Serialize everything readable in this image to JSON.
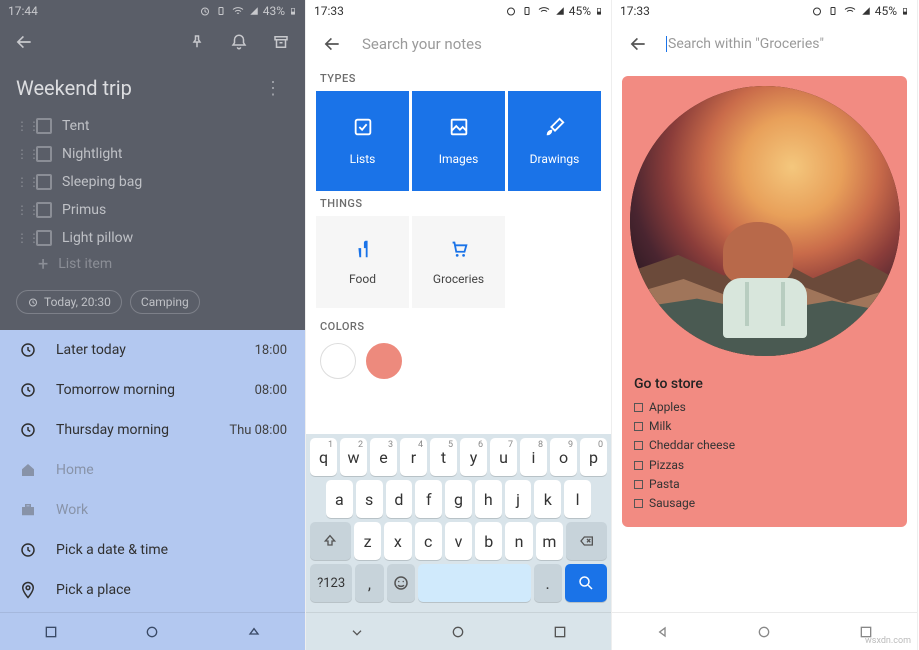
{
  "phone1": {
    "status": {
      "time": "17:44",
      "battery": "43%"
    },
    "title": "Weekend trip",
    "items": [
      "Tent",
      "Nightlight",
      "Sleeping bag",
      "Primus",
      "Light pillow"
    ],
    "add_placeholder": "List item",
    "chips": {
      "reminder": "Today, 20:30",
      "tag": "Camping"
    },
    "sheet": {
      "later": {
        "label": "Later today",
        "time": "18:00"
      },
      "tomorrow": {
        "label": "Tomorrow morning",
        "time": "08:00"
      },
      "thursday": {
        "label": "Thursday morning",
        "time": "Thu 08:00"
      },
      "home": "Home",
      "work": "Work",
      "pickdate": "Pick a date & time",
      "pickplace": "Pick a place"
    }
  },
  "phone2": {
    "status": {
      "time": "17:33",
      "battery": "45%"
    },
    "search_placeholder": "Search your notes",
    "sections": {
      "types": "TYPES",
      "things": "THINGS",
      "colors": "COLORS"
    },
    "types": {
      "lists": "Lists",
      "images": "Images",
      "drawings": "Drawings"
    },
    "things": {
      "food": "Food",
      "groceries": "Groceries"
    },
    "colors": [
      "#ffffff",
      "#ed8a7d"
    ],
    "keyboard": {
      "row1": [
        "q",
        "w",
        "e",
        "r",
        "t",
        "y",
        "u",
        "i",
        "o",
        "p"
      ],
      "nums": [
        "1",
        "2",
        "3",
        "4",
        "5",
        "6",
        "7",
        "8",
        "9",
        "0"
      ],
      "row2": [
        "a",
        "s",
        "d",
        "f",
        "g",
        "h",
        "j",
        "k",
        "l"
      ],
      "row3": [
        "z",
        "x",
        "c",
        "v",
        "b",
        "n",
        "m"
      ],
      "sym": "?123",
      "comma": ",",
      "period": "."
    }
  },
  "phone3": {
    "status": {
      "time": "17:33",
      "battery": "45%"
    },
    "search_placeholder": "Search within \"Groceries\"",
    "card": {
      "title": "Go to store",
      "items": [
        "Apples",
        "Milk",
        "Cheddar cheese",
        "Pizzas",
        "Pasta",
        "Sausage"
      ]
    }
  },
  "watermark": "wsxdn.com"
}
